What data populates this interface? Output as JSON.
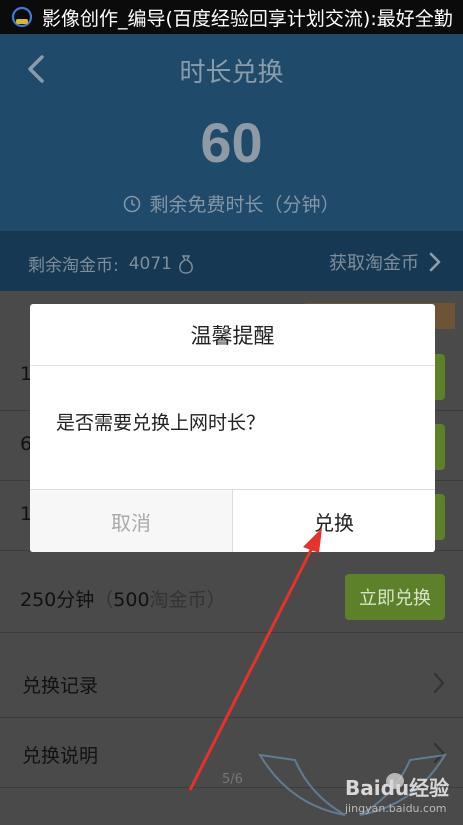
{
  "status_bar": {
    "title": "影像创作_编导(百度经验回享计划交流):最好全勤"
  },
  "header": {
    "title": "时长兑换",
    "remaining_minutes": "60",
    "remaining_label": "剩余免费时长（分钟）"
  },
  "coin_bar": {
    "label": "剩余淘金币:",
    "count": "4071",
    "get_coins_label": "获取淘金币"
  },
  "options": [
    {
      "text_visible": "1"
    },
    {
      "text_visible": "6"
    },
    {
      "text_visible": "1"
    },
    {
      "minutes": "250分钟",
      "paren_open": "（",
      "coins": "500",
      "unit": "淘金币",
      "paren_close": "）",
      "button": "立即兑换"
    }
  ],
  "links": [
    {
      "label": "兑换记录"
    },
    {
      "label": "兑换说明"
    }
  ],
  "dialog": {
    "title": "温馨提醒",
    "message": "是否需要兑换上网时长？",
    "cancel_label": "取消",
    "confirm_label": "兑换"
  },
  "page_indicator": "5/6",
  "watermark": {
    "brand": "Baidu经验",
    "url": "jingyan.baidu.com"
  },
  "colors": {
    "header_bg": "#1f4a69",
    "coin_bar_bg": "#173852",
    "button_green": "#5d802b",
    "arrow_red": "#e8312a"
  },
  "icons": [
    "app-icon",
    "back-icon",
    "clock-icon",
    "coin-bag-icon",
    "chevron-right-icon"
  ]
}
